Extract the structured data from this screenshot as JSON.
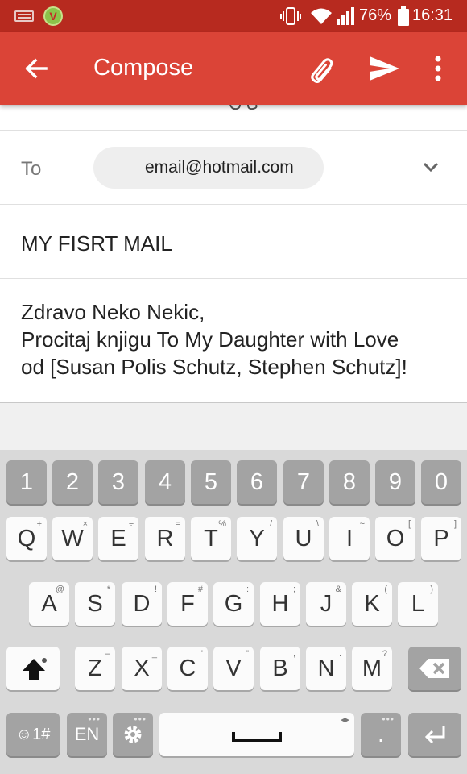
{
  "status_bar": {
    "battery_percent": "76%",
    "time": "16:31",
    "app_badge": "V",
    "icons": [
      "keyboard-icon",
      "app-icon",
      "vibrate-icon",
      "wifi-icon",
      "signal-icon",
      "battery-icon"
    ]
  },
  "app_bar": {
    "title": "Compose",
    "icons": [
      "back-arrow-icon",
      "attach-icon",
      "send-icon",
      "more-vert-icon"
    ]
  },
  "compose": {
    "to_label": "To",
    "to_recipient": "email@hotmail.com",
    "subject": "MY FISRT MAIL",
    "body_lines": [
      "Zdravo Neko Nekic,",
      "Procitaj knjigu To My Daughter with Love",
      "od [Susan Polis Schutz, Stephen Schutz]!"
    ]
  },
  "keyboard": {
    "number_row": [
      "1",
      "2",
      "3",
      "4",
      "5",
      "6",
      "7",
      "8",
      "9",
      "0"
    ],
    "row1": [
      {
        "label": "Q",
        "hint": "+"
      },
      {
        "label": "W",
        "hint": "×"
      },
      {
        "label": "E",
        "hint": "÷"
      },
      {
        "label": "R",
        "hint": "="
      },
      {
        "label": "T",
        "hint": "%"
      },
      {
        "label": "Y",
        "hint": "/"
      },
      {
        "label": "U",
        "hint": "\\"
      },
      {
        "label": "I",
        "hint": "~"
      },
      {
        "label": "O",
        "hint": "["
      },
      {
        "label": "P",
        "hint": "]"
      }
    ],
    "row2": [
      {
        "label": "A",
        "hint": "@"
      },
      {
        "label": "S",
        "hint": "*"
      },
      {
        "label": "D",
        "hint": "!"
      },
      {
        "label": "F",
        "hint": "#"
      },
      {
        "label": "G",
        "hint": ":"
      },
      {
        "label": "H",
        "hint": ";"
      },
      {
        "label": "J",
        "hint": "&"
      },
      {
        "label": "K",
        "hint": "("
      },
      {
        "label": "L",
        "hint": ")"
      }
    ],
    "row3": [
      {
        "label": "Z",
        "hint": "–"
      },
      {
        "label": "X",
        "hint": "_"
      },
      {
        "label": "C",
        "hint": "'"
      },
      {
        "label": "V",
        "hint": "\""
      },
      {
        "label": "B",
        "hint": ","
      },
      {
        "label": "N",
        "hint": "."
      },
      {
        "label": "M",
        "hint": "?"
      }
    ],
    "symbols_label": "☺1#",
    "language_label": "EN",
    "period_label": ".",
    "more_dots": "•••",
    "space_arrows": "◂▸"
  }
}
